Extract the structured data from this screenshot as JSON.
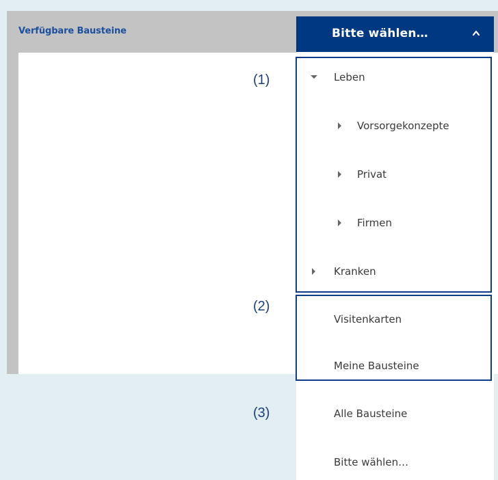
{
  "panel": {
    "title": "Verfügbare Bausteine"
  },
  "select": {
    "current": "Bitte wählen…",
    "icon": "chevron-up-icon"
  },
  "tree": {
    "leben": {
      "label": "Leben",
      "expanded": true,
      "icon": "caret-down-icon"
    },
    "vorsorgekonzepte": {
      "label": "Vorsorgekonzepte",
      "icon": "caret-right-icon"
    },
    "privat": {
      "label": "Privat",
      "icon": "caret-right-icon"
    },
    "firmen": {
      "label": "Firmen",
      "icon": "caret-right-icon"
    },
    "kranken": {
      "label": "Kranken",
      "expanded": false,
      "icon": "caret-right-icon"
    }
  },
  "options": {
    "visitenkarten": "Visitenkarten",
    "meine_bausteine": "Meine Bausteine",
    "alle_bausteine": "Alle Bausteine",
    "bitte_waehlen": "Bitte wählen…"
  },
  "callouts": {
    "one": "(1)",
    "two": "(2)",
    "three": "(3)"
  },
  "colors": {
    "accent": "#003882",
    "title": "#1c4f9c",
    "highlight_border": "#0b3c87",
    "panel_bg": "#c3c3c3",
    "page_bg": "#e3eef2"
  }
}
